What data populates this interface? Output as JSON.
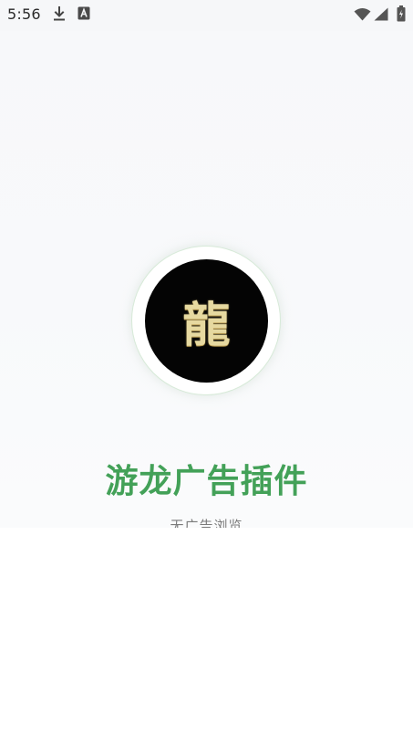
{
  "status_bar": {
    "time": "5:56",
    "icons": [
      "download-icon",
      "a-icon",
      "wifi-icon",
      "signal-icon",
      "battery-icon"
    ]
  },
  "splash": {
    "logo_glyph": "龍",
    "app_name": "游龙广告插件",
    "tagline": "无广告浏览"
  },
  "colors": {
    "title_green": "#43a158",
    "logo_gold": "#e6d9a0",
    "logo_black": "#040404",
    "ring_border": "#d7ead8"
  }
}
